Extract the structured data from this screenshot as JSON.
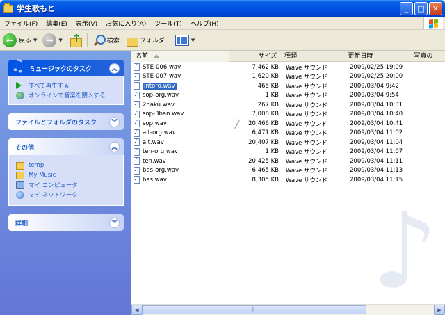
{
  "window": {
    "title": "学生歌もと"
  },
  "menu": [
    "ファイル(F)",
    "編集(E)",
    "表示(V)",
    "お気に入り(A)",
    "ツール(T)",
    "ヘルプ(H)"
  ],
  "toolbar": {
    "back_label": "戻る",
    "search_label": "検索",
    "folders_label": "フォルダ"
  },
  "tasks": {
    "music": {
      "title": "ミュージックのタスク",
      "items": [
        "すべて再生する",
        "オンラインで音楽を購入する"
      ]
    },
    "file": {
      "title": "ファイルとフォルダのタスク"
    },
    "other": {
      "title": "その他",
      "items": [
        "temp",
        "My Music",
        "マイ コンピュータ",
        "マイ ネットワーク"
      ]
    },
    "details": {
      "title": "詳細"
    }
  },
  "columns": {
    "name": "名前",
    "size": "サイズ",
    "type": "種類",
    "date": "更新日時",
    "photo": "写真の"
  },
  "files": [
    {
      "name": "STE-006.wav",
      "size": "7,462 KB",
      "type": "Wave サウンド",
      "date": "2009/02/25 19:09"
    },
    {
      "name": "STE-007.wav",
      "size": "1,620 KB",
      "type": "Wave サウンド",
      "date": "2009/02/25 20:00"
    },
    {
      "name": "intoro.wav",
      "size": "465 KB",
      "type": "Wave サウンド",
      "date": "2009/03/04 9:42"
    },
    {
      "name": "sop-org.wav",
      "size": "1 KB",
      "type": "Wave サウンド",
      "date": "2009/03/04 9:54"
    },
    {
      "name": "2haku.wav",
      "size": "267 KB",
      "type": "Wave サウンド",
      "date": "2009/03/04 10:31"
    },
    {
      "name": "sop-3ban.wav",
      "size": "7,008 KB",
      "type": "Wave サウンド",
      "date": "2009/03/04 10:40"
    },
    {
      "name": "sop.wav",
      "size": "20,466 KB",
      "type": "Wave サウンド",
      "date": "2009/03/04 10:41"
    },
    {
      "name": "alt-org.wav",
      "size": "6,471 KB",
      "type": "Wave サウンド",
      "date": "2009/03/04 11:02"
    },
    {
      "name": "alt.wav",
      "size": "20,407 KB",
      "type": "Wave サウンド",
      "date": "2009/03/04 11:04"
    },
    {
      "name": "ten-org.wav",
      "size": "1 KB",
      "type": "Wave サウンド",
      "date": "2009/03/04 11:07"
    },
    {
      "name": "ten.wav",
      "size": "20,425 KB",
      "type": "Wave サウンド",
      "date": "2009/03/04 11:11"
    },
    {
      "name": "bas-org.wav",
      "size": "6,465 KB",
      "type": "Wave サウンド",
      "date": "2009/03/04 11:13"
    },
    {
      "name": "bas.wav",
      "size": "8,305 KB",
      "type": "Wave サウンド",
      "date": "2009/03/04 11:15"
    }
  ]
}
